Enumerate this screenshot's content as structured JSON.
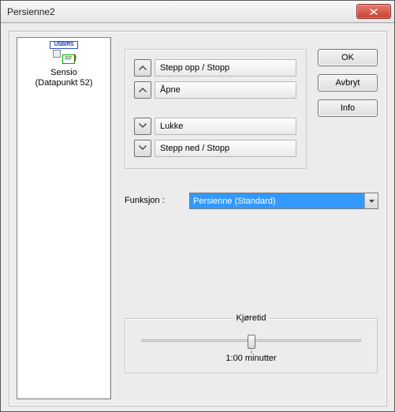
{
  "window": {
    "title": "Persienne2"
  },
  "device": {
    "line1": "Sensio",
    "line2": "(Datapunkt 52)",
    "usb_label": "USB/RS",
    "rf_label": "RF"
  },
  "controls": {
    "step_up": "Stepp opp / Stopp",
    "open": "Åpne",
    "close": "Lukke",
    "step_down": "Stepp ned / Stopp"
  },
  "buttons": {
    "ok": "OK",
    "cancel": "Avbryt",
    "info": "Info"
  },
  "funksjon": {
    "label": "Funksjon :",
    "selected": "Persienne (Standard)"
  },
  "runtime": {
    "legend": "Kjøretid",
    "value": "1:00 minutter"
  }
}
